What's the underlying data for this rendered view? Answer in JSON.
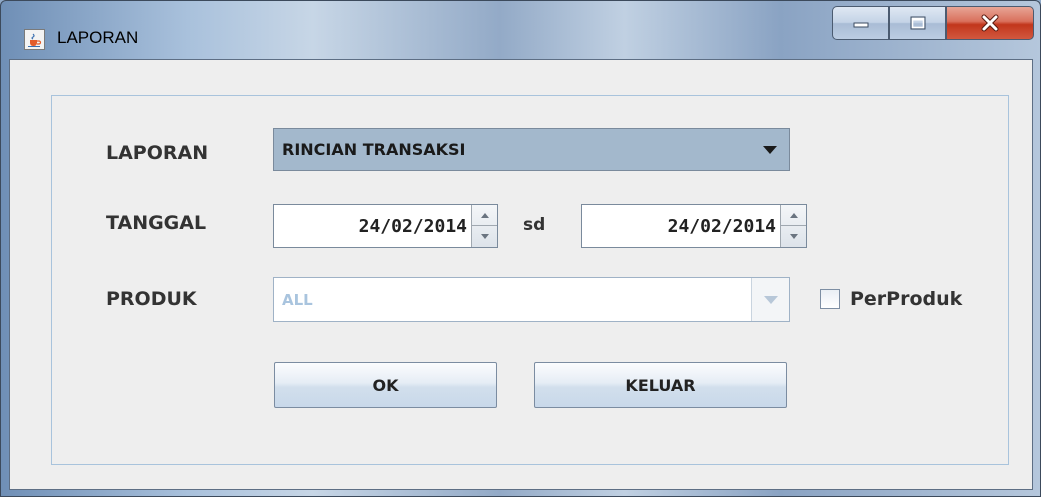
{
  "window": {
    "title": "LAPORAN",
    "icons": {
      "app": "java-cup-icon",
      "minimize": "minimize-icon",
      "maximize": "maximize-icon",
      "close": "close-icon"
    }
  },
  "form": {
    "laporan": {
      "label": "LAPORAN",
      "selected": "RINCIAN TRANSAKSI"
    },
    "tanggal": {
      "label": "TANGGAL",
      "from": "24/02/2014",
      "separator": "sd",
      "to": "24/02/2014"
    },
    "produk": {
      "label": "PRODUK",
      "selected": "ALL",
      "enabled": false,
      "checkbox_label": "PerProduk",
      "checkbox_checked": false
    },
    "buttons": {
      "ok": "OK",
      "keluar": "KELUAR"
    }
  },
  "colors": {
    "combo_selected_bg": "#a3b8cc",
    "disabled_text": "#a9c4de",
    "close_button": "#c9432a",
    "panel_border": "#a8c3dc"
  }
}
